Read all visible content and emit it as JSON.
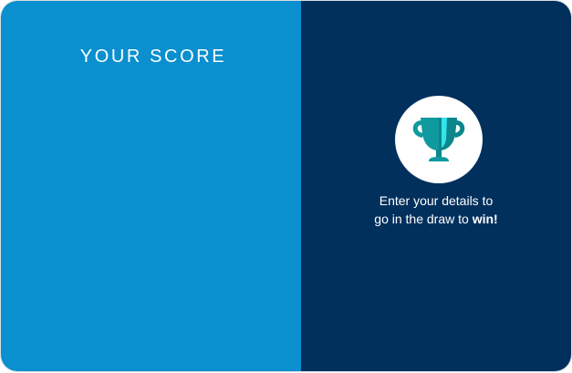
{
  "score_panel": {
    "heading": "YOUR SCORE",
    "background_color": "#0a8fcf"
  },
  "prize_panel": {
    "background_color": "#02305d",
    "icon": "trophy-icon",
    "icon_color": "#0e9a9f",
    "message_line1": "Enter your details to",
    "message_line2_prefix": "go in the draw to ",
    "message_line2_emphasis": "win!"
  }
}
